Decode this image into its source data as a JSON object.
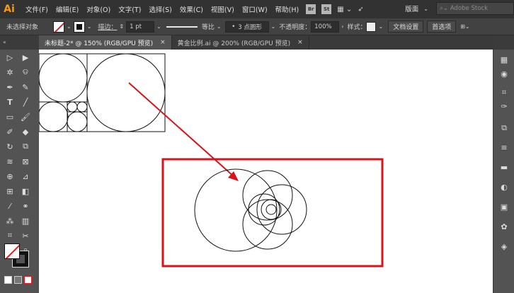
{
  "app": {
    "logo": "Ai"
  },
  "menu": [
    "文件(F)",
    "编辑(E)",
    "对象(O)",
    "文字(T)",
    "选择(S)",
    "效果(C)",
    "视图(V)",
    "窗口(W)",
    "帮助(H)"
  ],
  "menubar_badges": {
    "bridge": "Br",
    "stock": "St"
  },
  "workspace": {
    "label": "版面"
  },
  "search": {
    "placeholder": "Adobe Stock"
  },
  "control": {
    "selection_status": "未选择对象",
    "stroke_label": "描边：",
    "stroke_weight": "1 pt",
    "profile_label": "等比",
    "brush_label": "3 点圆形",
    "opacity_label": "不透明度：",
    "opacity_value": "100%",
    "style_label": "样式：",
    "doc_setup_button": "文档设置",
    "preferences_button": "首选项"
  },
  "tabs": [
    {
      "label": "未标题-2* @ 150% (RGB/GPU 预览)",
      "close": "×"
    },
    {
      "label": "黄金比例.ai @ 200% (RGB/GPU 预览)",
      "close": "×"
    }
  ],
  "colors": {
    "highlight_rect": "#d8141a",
    "arrow": "#d8141a",
    "stroke": "#111111"
  },
  "toolbar_icons": [
    "selection-tool",
    "direct-selection-tool",
    "magic-wand-tool",
    "lasso-tool",
    "pen-tool",
    "curvature-tool",
    "type-tool",
    "line-tool",
    "rectangle-tool",
    "paintbrush-tool",
    "shaper-tool",
    "eraser-tool",
    "rotate-tool",
    "scale-tool",
    "width-tool",
    "free-transform-tool",
    "shape-builder-tool",
    "perspective-tool",
    "mesh-tool",
    "gradient-tool",
    "eyedropper-tool",
    "blend-tool",
    "symbol-sprayer-tool",
    "graph-tool",
    "artboard-tool",
    "slice-tool",
    "hand-tool",
    "zoom-tool"
  ],
  "right_panel_icons": [
    "color-icon",
    "color-guide-icon",
    "swatches-icon",
    "brushes-icon",
    "symbols-icon",
    "stroke-icon",
    "gradient-icon",
    "transparency-icon",
    "appearance-icon",
    "graphic-styles-icon",
    "layers-icon"
  ]
}
